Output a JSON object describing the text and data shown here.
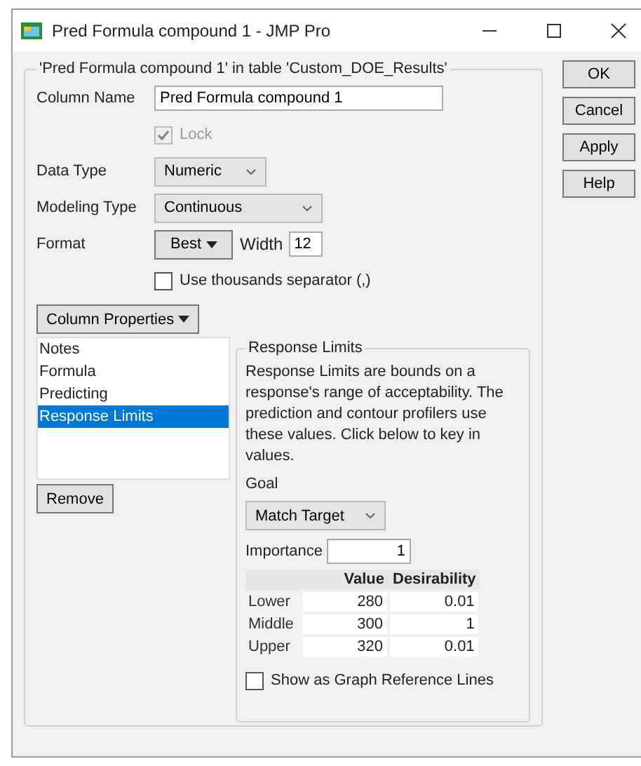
{
  "window": {
    "title": "Pred Formula compound 1 - JMP Pro"
  },
  "panel": {
    "title": "'Pred Formula compound 1' in table 'Custom_DOE_Results'",
    "column_name": {
      "label": "Column Name",
      "value": "Pred Formula compound 1"
    },
    "lock": {
      "label": "Lock",
      "checked": true,
      "disabled": true
    },
    "data_type": {
      "label": "Data Type",
      "value": "Numeric"
    },
    "modeling_type": {
      "label": "Modeling Type",
      "value": "Continuous"
    },
    "format": {
      "label": "Format",
      "value": "Best",
      "width_label": "Width",
      "width_value": "12"
    },
    "thousands_separator": {
      "label": "Use thousands separator (,)",
      "checked": false
    },
    "column_properties": {
      "label": "Column Properties"
    },
    "properties": [
      {
        "label": "Notes",
        "selected": false
      },
      {
        "label": "Formula",
        "selected": false
      },
      {
        "label": "Predicting",
        "selected": false
      },
      {
        "label": "Response Limits",
        "selected": true
      }
    ],
    "remove_button": "Remove",
    "response_limits": {
      "title": "Response Limits",
      "description": "Response Limits are bounds on a response's range of acceptability. The prediction and contour profilers use these values. Click below to key in values.",
      "goal_label": "Goal",
      "goal_value": "Match Target",
      "importance_label": "Importance",
      "importance_value": "1",
      "columns": [
        "Value",
        "Desirability"
      ],
      "rows": [
        {
          "label": "Lower",
          "value": "280",
          "desirability": "0.01"
        },
        {
          "label": "Middle",
          "value": "300",
          "desirability": "1"
        },
        {
          "label": "Upper",
          "value": "320",
          "desirability": "0.01"
        }
      ],
      "reference_lines": {
        "label": "Show as Graph Reference Lines",
        "checked": false
      }
    }
  },
  "buttons": [
    "OK",
    "Cancel",
    "Apply",
    "Help"
  ]
}
